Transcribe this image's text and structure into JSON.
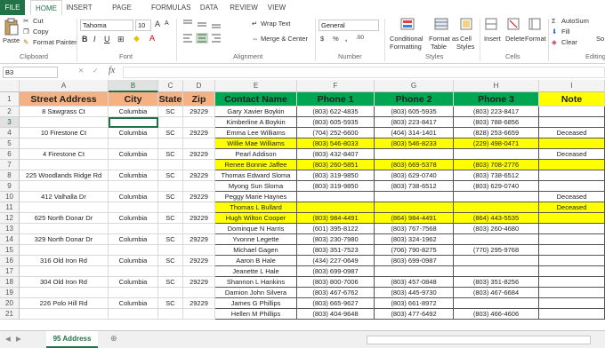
{
  "ribbon_tabs": [
    "FILE",
    "HOME",
    "INSERT",
    "PAGE LAYOUT",
    "FORMULAS",
    "DATA",
    "REVIEW",
    "VIEW"
  ],
  "clipboard": {
    "paste": "Paste",
    "cut": "Cut",
    "copy": "Copy",
    "format_painter": "Format Painter",
    "label": "Clipboard"
  },
  "font": {
    "name": "Tahoma",
    "size": "10",
    "bold": "B",
    "italic": "I",
    "underline": "U",
    "grow": "A",
    "shrink": "A",
    "label": "Font"
  },
  "alignment": {
    "wrap": "Wrap Text",
    "merge": "Merge & Center",
    "label": "Alignment"
  },
  "number": {
    "format": "General",
    "currency": "$",
    "percent": "%",
    "comma": ",",
    "inc": ".00",
    "label": "Number"
  },
  "styles": {
    "cond": "Conditional",
    "cond2": "Formatting",
    "fmt_table": "Format as",
    "fmt_table2": "Table",
    "cell_styles": "Cell",
    "cell_styles2": "Styles",
    "label": "Styles"
  },
  "cells": {
    "insert": "Insert",
    "delete": "Delete",
    "format": "Format",
    "label": "Cells"
  },
  "editing": {
    "autosum": "AutoSum",
    "fill": "Fill",
    "clear": "Clear",
    "sort": "So",
    "label": "Editing"
  },
  "formula_bar": {
    "name_box": "B3",
    "fx": "fx",
    "content": ""
  },
  "columns": [
    "A",
    "B",
    "C",
    "D",
    "E",
    "F",
    "G",
    "H",
    "I"
  ],
  "headers": [
    "Street Address",
    "City",
    "State",
    "Zip",
    "Contact Name",
    "Phone 1",
    "Phone 2",
    "Phone 3",
    "Note"
  ],
  "rows": [
    [
      "8 Sawgrass Ct",
      "Columbia",
      "SC",
      "29229",
      "Gary Xavier Boykin",
      "(803) 622-4835",
      "(803) 605-5935",
      "(803) 223-8417",
      ""
    ],
    [
      "",
      "",
      "",
      "",
      "Kimberline A Boykin",
      "(803) 605-5935",
      "(803) 223-8417",
      "(803) 788-6856",
      ""
    ],
    [
      "10 Firestone Ct",
      "Columbia",
      "SC",
      "29229",
      "Emma Lee Williams",
      "(704) 252-6600",
      "(404) 314-1401",
      "(828) 253-6659",
      "Deceased"
    ],
    [
      "",
      "",
      "",
      "",
      "Willie Mae Williams",
      "(803) 546-8033",
      "(803) 546-8233",
      "(229) 498-0471",
      ""
    ],
    [
      "4 Firestone Ct",
      "Columbia",
      "SC",
      "29229",
      "Pearl Addison",
      "(803) 432-8407",
      "",
      "",
      "Deceased"
    ],
    [
      "",
      "",
      "",
      "",
      "Renee Bonnie Jaffee",
      "(803) 260-5851",
      "(803) 669-5378",
      "(803) 708-2776",
      ""
    ],
    [
      "225 Woodlands Ridge Rd",
      "Columbia",
      "SC",
      "29229",
      "Thomas Edward Sloma",
      "(803) 319-9850",
      "(803) 629-0740",
      "(803) 738-6512",
      ""
    ],
    [
      "",
      "",
      "",
      "",
      "Myong Sun Sloma",
      "(803) 319-9850",
      "(803) 738-6512",
      "(803) 629-0740",
      ""
    ],
    [
      "412 Valhalla Dr",
      "Columbia",
      "SC",
      "29229",
      "Peggy Marie Haynes",
      "",
      "",
      "",
      "Deceased"
    ],
    [
      "",
      "",
      "",
      "",
      "Thomas L Bullard",
      "",
      "",
      "",
      "Deceased"
    ],
    [
      "625 North Donar Dr",
      "Columbia",
      "SC",
      "29229",
      "Hugh Wilton Cooper",
      "(803) 984-4491",
      "(864) 984-4491",
      "(864) 443-5535",
      ""
    ],
    [
      "",
      "",
      "",
      "",
      "Dominque N Harris",
      "(601) 395-8122",
      "(803) 767-7568",
      "(803) 260-4680",
      ""
    ],
    [
      "329 North Donar Dr",
      "Columbia",
      "SC",
      "29229",
      "Yvonne Legette",
      "(803) 230-7980",
      "(803) 324-1962",
      "",
      ""
    ],
    [
      "",
      "",
      "",
      "",
      "Michael Gagen",
      "(803) 351-7523",
      "(706) 790-8275",
      "(770) 295-9768",
      ""
    ],
    [
      "316 Old Iron Rd",
      "Columbia",
      "SC",
      "29229",
      "Aaron B Hale",
      "(434) 227-0649",
      "(803) 699-0987",
      "",
      ""
    ],
    [
      "",
      "",
      "",
      "",
      "Jeanette L Hale",
      "(803) 699-0987",
      "",
      "",
      ""
    ],
    [
      "304 Old Iron Rd",
      "Columbia",
      "SC",
      "29229",
      "Shannon L Hankins",
      "(803) 800-7006",
      "(803) 457-0848",
      "(803) 351-8256",
      ""
    ],
    [
      "",
      "",
      "",
      "",
      "Damion John Silvera",
      "(803) 467-6762",
      "(803) 445-9730",
      "(803) 467-6684",
      ""
    ],
    [
      "226 Polo Hill Rd",
      "Columbia",
      "SC",
      "29229",
      "James G Phillips",
      "(803) 665-9627",
      "(803) 661-8972",
      "",
      ""
    ],
    [
      "",
      "",
      "",
      "",
      "Hellen M Phillips",
      "(803) 404-9648",
      "(803) 477-6492",
      "(803) 466-4606",
      ""
    ]
  ],
  "highlight_rows": [
    3,
    5,
    9,
    10
  ],
  "row_numbers": [
    "1",
    "2",
    "3",
    "4",
    "5",
    "6",
    "7",
    "8",
    "9",
    "10",
    "11",
    "12",
    "13",
    "14",
    "15",
    "16",
    "17",
    "18",
    "19",
    "20",
    "21"
  ],
  "sheet_tab": "95 Address",
  "colors": {
    "green": "#00a651",
    "salmon": "#f4b183",
    "yellow": "#ffff00",
    "excel": "#217346"
  }
}
